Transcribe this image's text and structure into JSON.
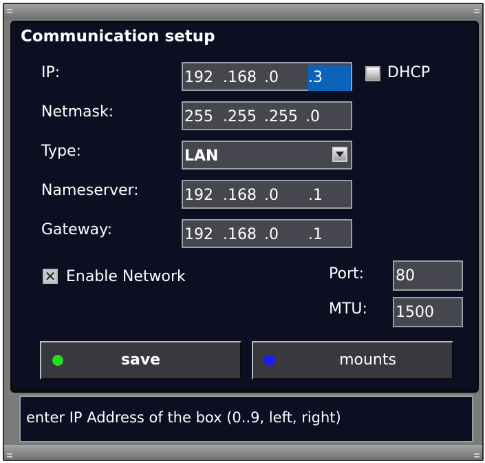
{
  "panel": {
    "title": "Communication setup"
  },
  "ip": {
    "label": "IP:",
    "octets": [
      "192",
      ".168",
      ".0",
      ".3"
    ],
    "selected_octet": 3
  },
  "dhcp": {
    "label": "DHCP",
    "checked": false
  },
  "netmask": {
    "label": "Netmask:",
    "octets": [
      "255",
      ".255",
      ".255",
      ".0"
    ]
  },
  "type": {
    "label": "Type:",
    "value": "LAN"
  },
  "nameserver": {
    "label": "Nameserver:",
    "octets": [
      "192",
      ".168",
      ".0",
      ".1"
    ]
  },
  "gateway": {
    "label": "Gateway:",
    "octets": [
      "192",
      ".168",
      ".0",
      ".1"
    ]
  },
  "enable_network": {
    "label": "Enable Network",
    "checked": true
  },
  "port": {
    "label": "Port:",
    "value": "80"
  },
  "mtu": {
    "label": "MTU:",
    "value": "1500"
  },
  "buttons": {
    "save": {
      "label": "save",
      "dot_color": "#22dd22"
    },
    "mounts": {
      "label": "mounts",
      "dot_color": "#1a1aff"
    }
  },
  "status_text": "enter IP Address of the box (0..9, left, right)",
  "colors": {
    "panel_bg": "#0c0f22",
    "field_bg": "#46464e",
    "selection": "#0a63b8"
  }
}
